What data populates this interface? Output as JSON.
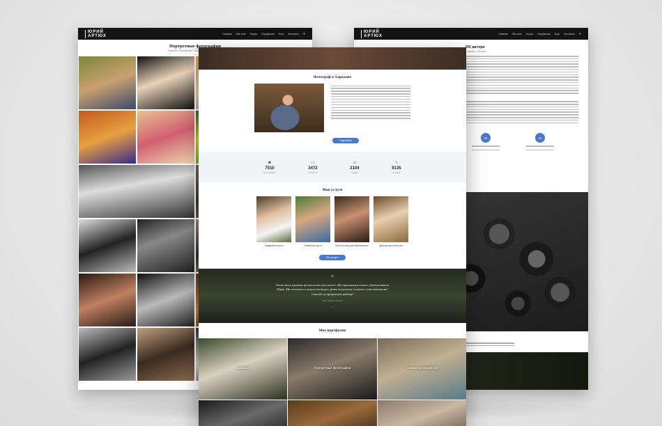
{
  "brand": {
    "line1": "ЮРИЙ",
    "line2": "АРТЮХ"
  },
  "nav": [
    "Главная",
    "Обо мне",
    "Услуги",
    "Портфолио",
    "Блог",
    "Контакты"
  ],
  "social_icon": "vk-icon",
  "left_page": {
    "title": "Портретные фотографии",
    "breadcrumb": "Главная / Портфолио / Портретные фотографии"
  },
  "right_page": {
    "title": "Об авторе",
    "breadcrumb": "Главная / Обо мне",
    "badges": [
      "08",
      "05"
    ]
  },
  "center_page": {
    "intro_title": "Фотограф в Харькове",
    "intro_button": "Подробнее",
    "stats": [
      {
        "icon": "camera-icon",
        "value": "7510",
        "label": "фотографий"
      },
      {
        "icon": "video-icon",
        "value": "3472",
        "label": "клиентов"
      },
      {
        "icon": "people-icon",
        "value": "2104",
        "label": "свадеб"
      },
      {
        "icon": "star-icon",
        "value": "9135",
        "label": "отзывов"
      }
    ],
    "services_title": "Мои услуги",
    "services": [
      "Свадебное фото",
      "Семейное фото",
      "Фотосессия для беременных",
      "Детская фотосессия"
    ],
    "services_button": "Все услуги",
    "quote": {
      "mark": "“",
      "text": "Очень было приятно фотосессия моих коллег. Мы приглашаем снова с удовольствием Юрия. Мы остались в полном восторге, фото получились сочными, естественными! Спасибо за прекрасную работу!",
      "author": "Анастасия Полякова",
      "dots": "• ○"
    },
    "portfolio_title": "Мое портфолио",
    "portfolio": [
      "Свадьба",
      "Портретные фотографии",
      "Съемка мероприятий"
    ]
  },
  "colors": {
    "accent": "#4a79c8",
    "header": "#141414"
  }
}
